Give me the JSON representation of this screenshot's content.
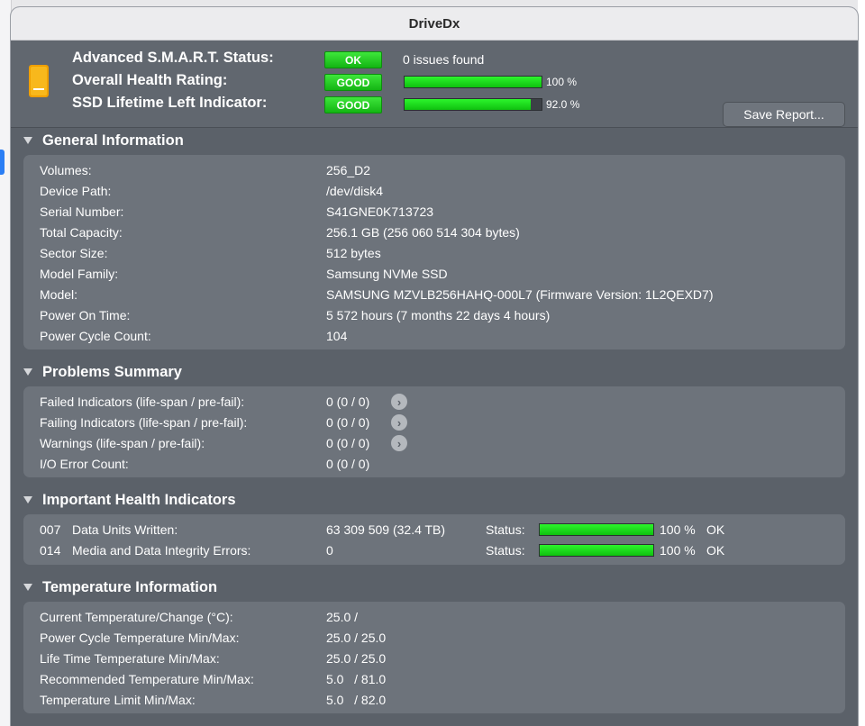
{
  "window": {
    "title": "DriveDx"
  },
  "header": {
    "smart_label": "Advanced S.M.A.R.T. Status:",
    "smart_badge": "OK",
    "smart_text": "0 issues found",
    "health_label": "Overall Health Rating:",
    "health_badge": "GOOD",
    "health_pct": "100 %",
    "health_value": 1.0,
    "life_label": "SSD Lifetime Left Indicator:",
    "life_badge": "GOOD",
    "life_pct": "92.0 %",
    "life_value": 0.92,
    "save_button": "Save Report...",
    "badge_color": "#22cc22",
    "bar_color": "#1ee01e"
  },
  "general": {
    "title": "General Information",
    "rows": [
      {
        "label": "Volumes:",
        "value": "256_D2"
      },
      {
        "label": "Device Path:",
        "value": "/dev/disk4"
      },
      {
        "label": "Serial Number:",
        "value": "S41GNE0K713723"
      },
      {
        "label": "Total Capacity:",
        "value": "256.1 GB (256 060 514 304 bytes)"
      },
      {
        "label": "Sector Size:",
        "value": "512 bytes"
      },
      {
        "label": "Model Family:",
        "value": "Samsung NVMe SSD"
      },
      {
        "label": "Model:",
        "value": "SAMSUNG MZVLB256HAHQ-000L7  (Firmware Version: 1L2QEXD7)"
      },
      {
        "label": "Power On Time:",
        "value": "5 572 hours (7 months 22 days 4 hours)"
      },
      {
        "label": "Power Cycle Count:",
        "value": "104"
      }
    ]
  },
  "problems": {
    "title": "Problems Summary",
    "rows": [
      {
        "label": "Failed Indicators (life-span / pre-fail):",
        "value": "0 (0 / 0)"
      },
      {
        "label": "Failing Indicators (life-span / pre-fail):",
        "value": "0 (0 / 0)"
      },
      {
        "label": "Warnings (life-span / pre-fail):",
        "value": "0 (0 / 0)"
      },
      {
        "label": "I/O Error Count:",
        "value": "0 (0 / 0)"
      }
    ],
    "arrow_icon": "right-arrow-circle-icon"
  },
  "health": {
    "title": "Important Health Indicators",
    "rows": [
      {
        "id": "007",
        "label": "Data Units Written:",
        "value": "63 309 509 (32.4 TB)",
        "status_label": "Status:",
        "pct": "100 %",
        "level": 1.0,
        "state": "OK"
      },
      {
        "id": "014",
        "label": "Media and Data Integrity Errors:",
        "value": "0",
        "status_label": "Status:",
        "pct": "100 %",
        "level": 1.0,
        "state": "OK"
      }
    ]
  },
  "temperature": {
    "title": "Temperature Information",
    "rows": [
      {
        "label": "Current Temperature/Change (°C):",
        "value": "25.0 /"
      },
      {
        "label": "Power Cycle Temperature Min/Max:",
        "value": "25.0 / 25.0"
      },
      {
        "label": "Life Time Temperature Min/Max:",
        "value": "25.0 / 25.0"
      },
      {
        "label": "Recommended Temperature Min/Max:",
        "value": "5.0   / 81.0"
      },
      {
        "label": "Temperature Limit Min/Max:",
        "value": "5.0   / 82.0"
      }
    ]
  }
}
